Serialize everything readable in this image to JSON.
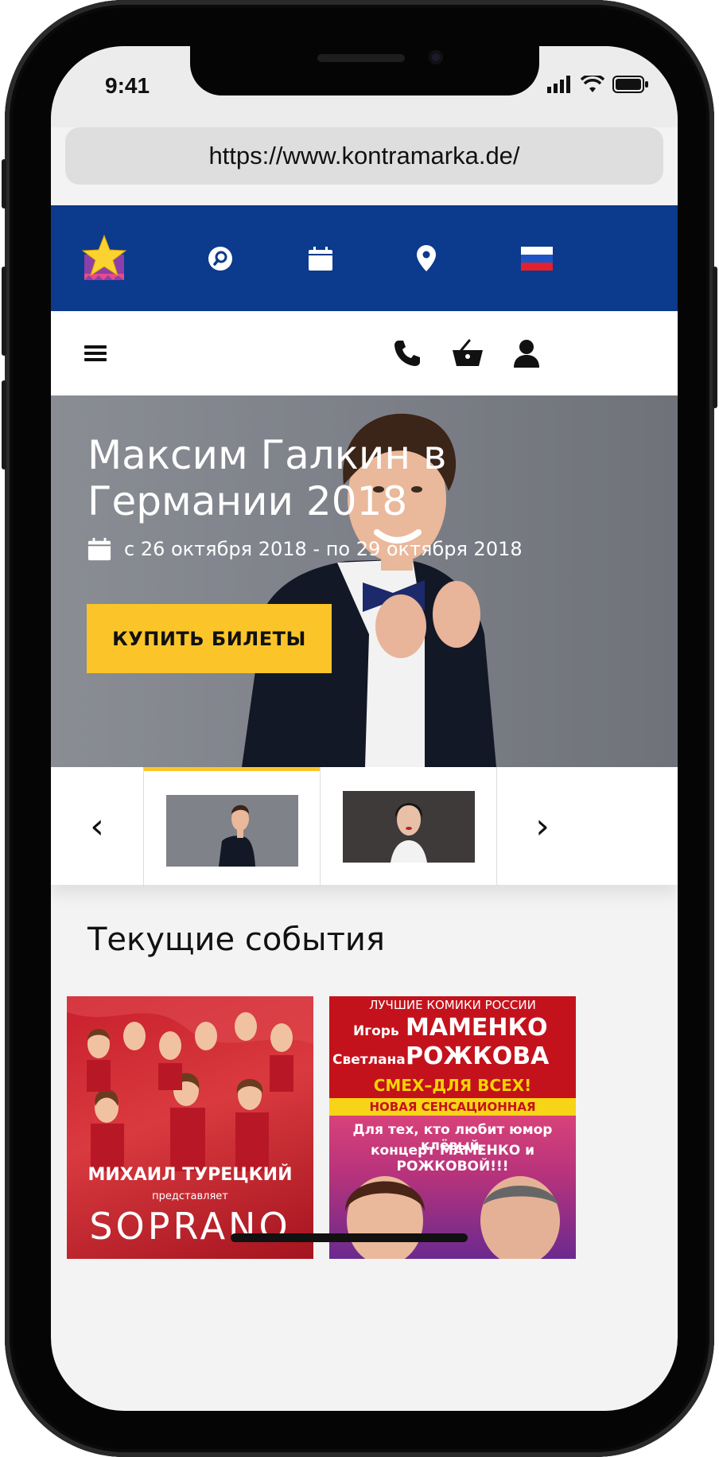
{
  "status": {
    "time": "9:41"
  },
  "browser": {
    "url": "https://www.kontramarka.de/"
  },
  "top_nav": {
    "icons": [
      "logo-star-icon",
      "search-icon",
      "calendar-icon",
      "location-pin-icon",
      "russian-flag-icon"
    ]
  },
  "secondary_nav": {
    "icons": [
      "hamburger-menu-icon",
      "phone-icon",
      "basket-icon",
      "user-icon"
    ]
  },
  "hero": {
    "title": "Максим Галкин в Германии 2018",
    "date": "с 26 октября 2018 - по 29 октября 2018",
    "buy_label": "КУПИТЬ БИЛЕТЫ"
  },
  "carousel": {
    "prev": "‹",
    "next": "›",
    "active_index": 0
  },
  "section": {
    "title": "Текущие события"
  },
  "events": [
    {
      "presenter": "МИХАИЛ ТУРЕЦКИЙ",
      "presents": "представляет",
      "title": "SOPRANO"
    },
    {
      "top": "ЛУЧШИЕ КОМИКИ РОССИИ",
      "artist1_first": "Игорь",
      "artist1_last": "МАМЕНКО",
      "artist2_first": "Светлана",
      "artist2_last": "РОЖКОВА",
      "slogan": "СМЕХ–ДЛЯ ВСЕХ!",
      "program": "НОВАЯ СЕНСАЦИОННАЯ ПРОГРАММА",
      "line1": "Для тех, кто любит юмор клёвый,",
      "line2": "концерт МАМЕНКО и РОЖКОВОЙ!!!"
    }
  ],
  "colors": {
    "brand_blue": "#0c3a8c",
    "accent_yellow": "#fbc52a"
  }
}
